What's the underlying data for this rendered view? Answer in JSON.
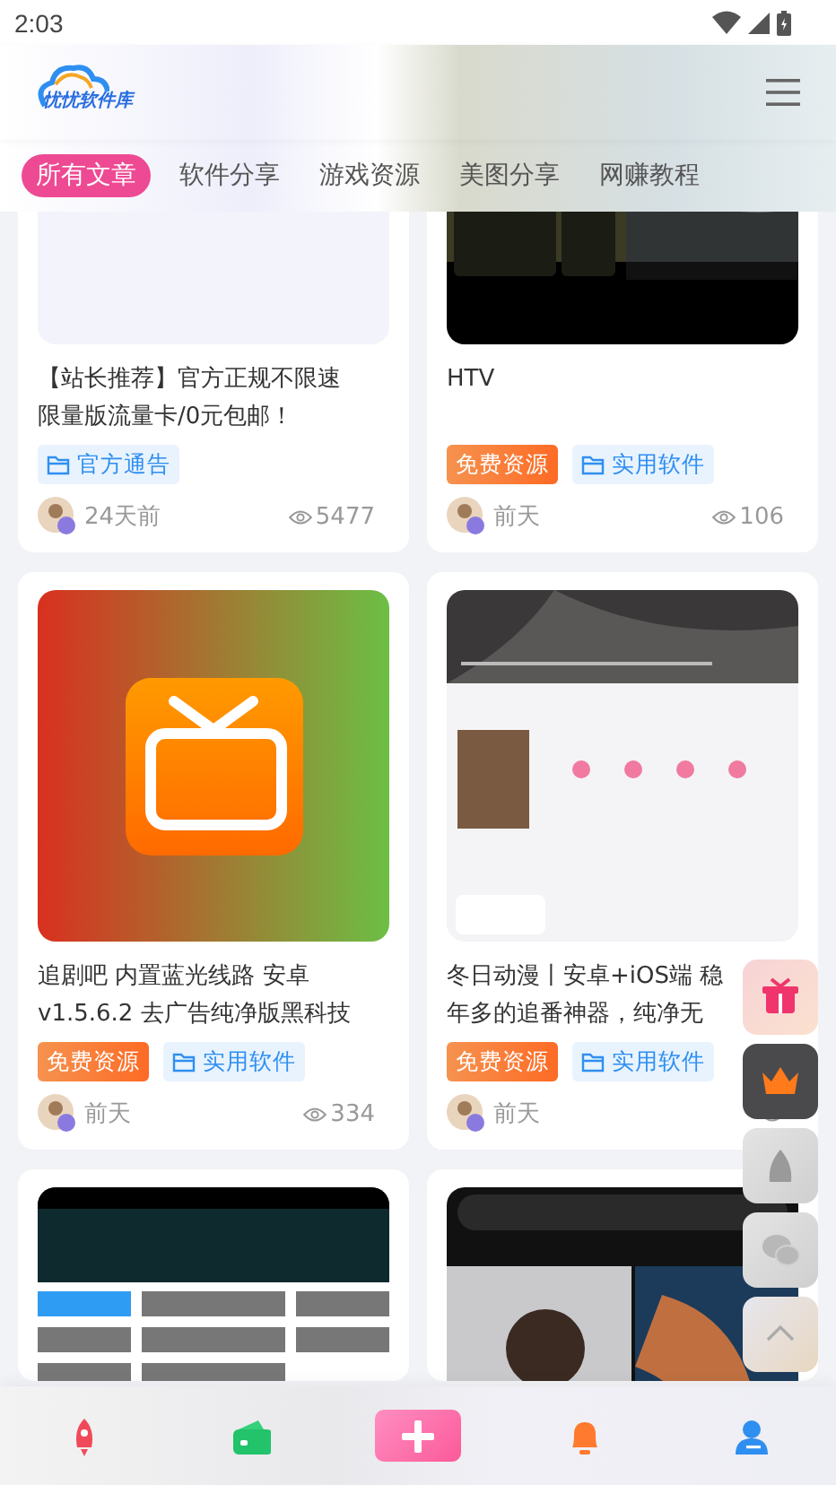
{
  "status_bar": {
    "time": "2:03"
  },
  "header": {
    "logo_text": "忧忧软件库"
  },
  "tabs": [
    {
      "label": "所有文章",
      "selected": true
    },
    {
      "label": "软件分享",
      "selected": false
    },
    {
      "label": "游戏资源",
      "selected": false
    },
    {
      "label": "美图分享",
      "selected": false
    },
    {
      "label": "网赚教程",
      "selected": false
    }
  ],
  "posts": [
    {
      "kind": "article",
      "title_lines": [
        "【站长推荐】官方正规不限速",
        "限量版流量卡/0元包邮！"
      ],
      "tags": [
        {
          "kind": "category",
          "label": "官方通告"
        }
      ],
      "time": "24天前",
      "views": "5477"
    },
    {
      "kind": "article",
      "title_lines": [
        "HTV"
      ],
      "tags": [
        {
          "kind": "free",
          "label": "免费资源"
        },
        {
          "kind": "category",
          "label": "实用软件"
        }
      ],
      "time": "前天",
      "views": "106"
    },
    {
      "kind": "article",
      "title_lines": [
        "追剧吧 内置蓝光线路 安卓",
        "v1.5.6.2 去广告纯净版黑科技"
      ],
      "tags": [
        {
          "kind": "free",
          "label": "免费资源"
        },
        {
          "kind": "category",
          "label": "实用软件"
        }
      ],
      "time": "前天",
      "views": "334"
    },
    {
      "kind": "article",
      "title_lines": [
        "冬日动漫丨安卓+iOS端 稳",
        "年多的追番神器，纯净无"
      ],
      "tags": [
        {
          "kind": "free",
          "label": "免费资源"
        },
        {
          "kind": "category",
          "label": "实用软件"
        }
      ],
      "time": "前天"
    },
    {
      "kind": "picture"
    },
    {
      "kind": "picture"
    }
  ],
  "float_buttons": [
    {
      "kind": "gift"
    },
    {
      "kind": "crown"
    },
    {
      "kind": "qq"
    },
    {
      "kind": "wechat"
    },
    {
      "kind": "top"
    }
  ],
  "bottom_nav": [
    {
      "kind": "rocket"
    },
    {
      "kind": "wallet"
    },
    {
      "kind": "add"
    },
    {
      "kind": "bell"
    },
    {
      "kind": "user"
    }
  ]
}
